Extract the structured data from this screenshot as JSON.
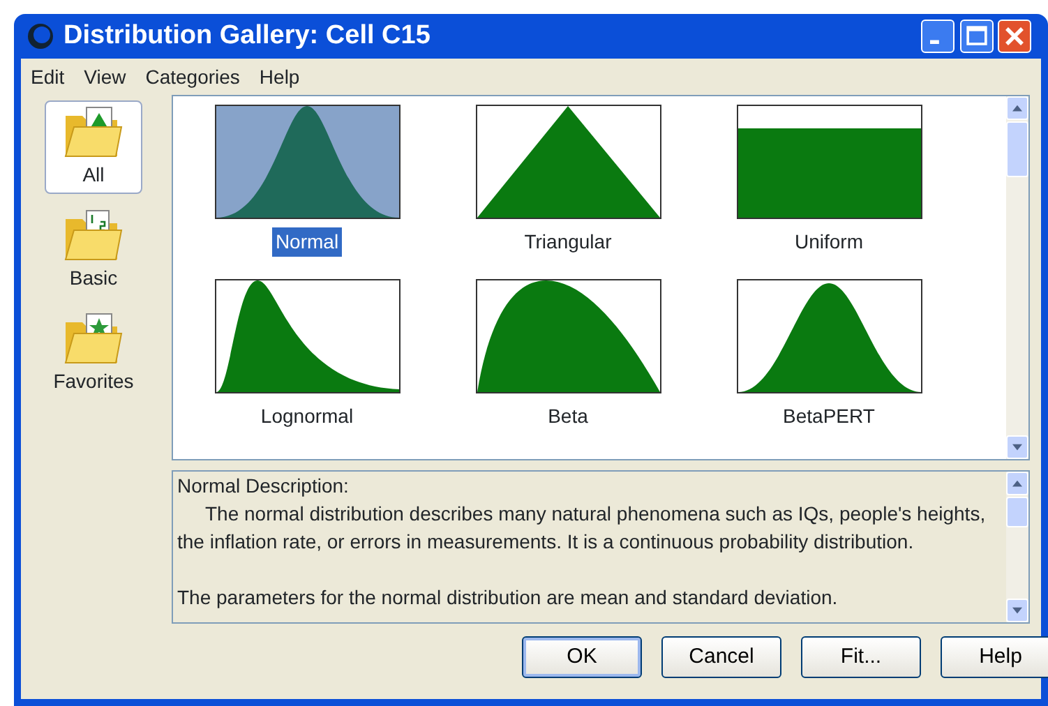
{
  "window": {
    "title": "Distribution Gallery: Cell C15"
  },
  "menu": [
    "Edit",
    "View",
    "Categories",
    "Help"
  ],
  "categories": [
    {
      "label": "All",
      "kind": "all",
      "selected": true
    },
    {
      "label": "Basic",
      "kind": "basic",
      "selected": false
    },
    {
      "label": "Favorites",
      "kind": "favorites",
      "selected": false
    }
  ],
  "distributions": [
    {
      "label": "Normal",
      "kind": "normal",
      "selected": true
    },
    {
      "label": "Triangular",
      "kind": "triangular",
      "selected": false
    },
    {
      "label": "Uniform",
      "kind": "uniform",
      "selected": false
    },
    {
      "label": "Lognormal",
      "kind": "lognormal",
      "selected": false
    },
    {
      "label": "Beta",
      "kind": "beta",
      "selected": false
    },
    {
      "label": "BetaPERT",
      "kind": "betapert",
      "selected": false
    }
  ],
  "description": {
    "heading": "Normal Description:",
    "text": "The normal distribution describes many natural phenomena such as IQs, people's heights, the inflation rate, or errors in measurements. It is a continuous probability distribution.",
    "parameters": "The parameters for the normal distribution are mean and standard deviation."
  },
  "buttons": [
    "OK",
    "Cancel",
    "Fit...",
    "Help"
  ]
}
